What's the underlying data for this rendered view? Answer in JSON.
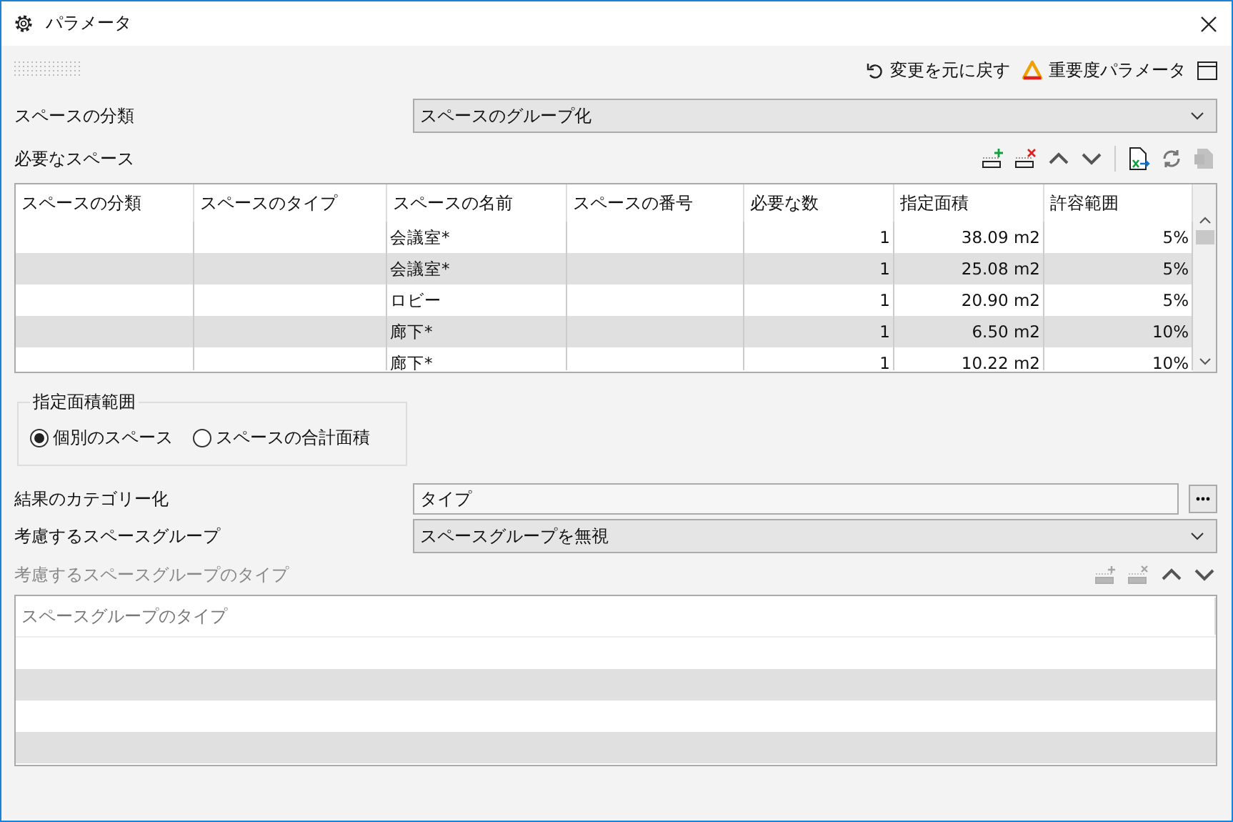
{
  "window": {
    "title": "パラメータ"
  },
  "top_actions": [
    {
      "kind": "undo",
      "label": "変更を元に戻す"
    },
    {
      "kind": "warning",
      "label": "重要度パラメータ"
    }
  ],
  "classification": {
    "label": "スペースの分類",
    "value": "スペースのグループ化"
  },
  "required_spaces": {
    "label": "必要なスペース",
    "toolbar": [
      {
        "kind": "add",
        "disabled": false
      },
      {
        "kind": "remove",
        "disabled": false
      },
      {
        "kind": "up",
        "disabled": false
      },
      {
        "kind": "down",
        "disabled": false
      },
      {
        "kind": "export",
        "disabled": false
      },
      {
        "kind": "refresh",
        "disabled": false
      },
      {
        "kind": "delete",
        "disabled": true
      }
    ],
    "columns": [
      "スペースの分類",
      "スペースのタイプ",
      "スペースの名前",
      "スペースの番号",
      "必要な数",
      "指定面積",
      "許容範囲"
    ],
    "rows": [
      [
        "",
        "",
        "会議室*",
        "",
        "1",
        "38.09 m2",
        "5%"
      ],
      [
        "",
        "",
        "会議室*",
        "",
        "1",
        "25.08 m2",
        "5%"
      ],
      [
        "",
        "",
        "ロビー",
        "",
        "1",
        "20.90 m2",
        "5%"
      ],
      [
        "",
        "",
        "廊下*",
        "",
        "1",
        "6.50 m2",
        "10%"
      ],
      [
        "",
        "",
        "廊下*",
        "",
        "1",
        "10.22 m2",
        "10%"
      ]
    ]
  },
  "area_range": {
    "title": "指定面積範囲",
    "options": [
      {
        "label": "個別のスペース",
        "selected": true
      },
      {
        "label": "スペースの合計面積",
        "selected": false
      }
    ]
  },
  "result_category": {
    "label": "結果のカテゴリー化",
    "value": "タイプ"
  },
  "space_group": {
    "label": "考慮するスペースグループ",
    "value": "スペースグループを無視"
  },
  "group_types": {
    "label": "考慮するスペースグループのタイプ",
    "disabled": true,
    "toolbar": [
      {
        "kind": "add",
        "disabled": true
      },
      {
        "kind": "remove",
        "disabled": true
      },
      {
        "kind": "up",
        "disabled": false
      },
      {
        "kind": "down",
        "disabled": false
      }
    ],
    "column": "スペースグループのタイプ"
  }
}
